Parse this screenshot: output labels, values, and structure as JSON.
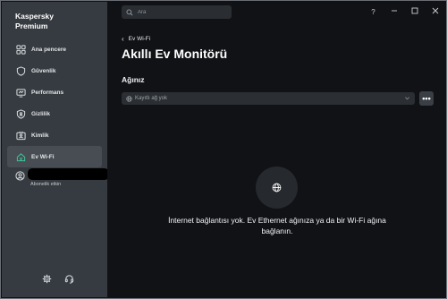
{
  "app": {
    "brand_line1": "Kaspersky",
    "brand_line2": "Premium"
  },
  "sidebar": {
    "items": [
      {
        "label": "Ana pencere",
        "icon": "home-grid-icon"
      },
      {
        "label": "Güvenlik",
        "icon": "shield-icon"
      },
      {
        "label": "Performans",
        "icon": "performance-icon"
      },
      {
        "label": "Gizlilik",
        "icon": "privacy-shield-icon"
      },
      {
        "label": "Kimlik",
        "icon": "identity-card-icon"
      },
      {
        "label": "Ev Wi-Fi",
        "icon": "home-wifi-icon",
        "active": true
      }
    ],
    "account_status": "Abonelik etkin"
  },
  "search": {
    "placeholder": "Ara"
  },
  "window_controls": {
    "help": "?"
  },
  "breadcrumb": {
    "back_label": "Ev Wi-Fi"
  },
  "page": {
    "title": "Akıllı Ev Monitörü",
    "section_title": "Ağınız",
    "network_select_value": "Kayıtlı ağ yok",
    "more_button_label": "•••",
    "empty_message": "İnternet bağlantısı yok. Ev Ethernet ağınıza ya da bir Wi-Fi ağına bağlanın."
  },
  "colors": {
    "accent": "#3fc39a",
    "sidebar_bg": "#353b40",
    "main_bg": "#101216"
  }
}
